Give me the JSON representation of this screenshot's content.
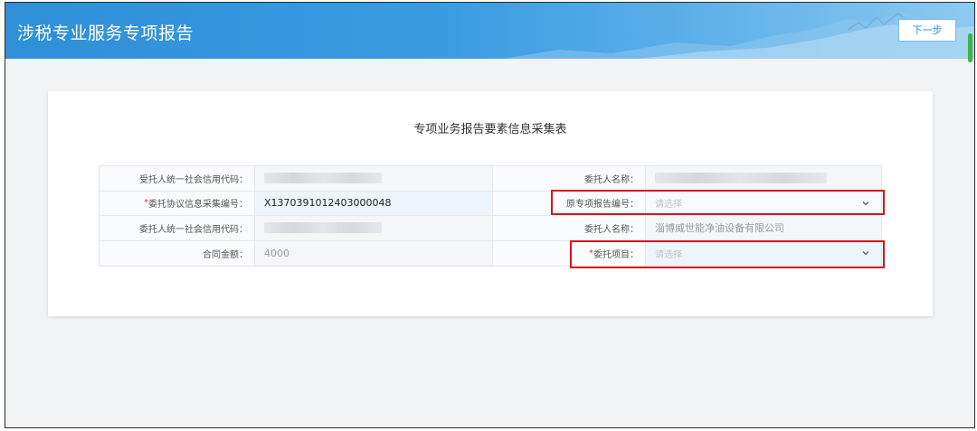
{
  "header": {
    "title": "涉税专业服务专项报告",
    "next_label": "下一步"
  },
  "form": {
    "title": "专项业务报告要素信息采集表",
    "rows": [
      {
        "left_label": "受托人统一社会信用代码：",
        "left_value": "",
        "left_required": false,
        "right_label": "委托人名称：",
        "right_value": "",
        "right_required": false
      },
      {
        "left_label": "委托协议信息采集编号：",
        "left_value": "X1370391012403000048",
        "left_required": true,
        "right_label": "原专项报告编号：",
        "right_placeholder": "请选择",
        "right_required": false
      },
      {
        "left_label": "委托人统一社会信用代码：",
        "left_value": "",
        "left_required": false,
        "right_label": "委托人名称：",
        "right_value": "淄博威世能净油设备有限公司",
        "right_required": false
      },
      {
        "left_label": "合同金额：",
        "left_value": "4000",
        "left_required": false,
        "right_label": "委托项目：",
        "right_placeholder": "请选择",
        "right_required": true
      }
    ]
  },
  "colors": {
    "header_blue": "#2f8fd8",
    "highlight_red": "#d9141b",
    "required_red": "#e23b3b"
  },
  "icons": {
    "select_arrow": "chevron-down-icon",
    "scroll_indicator": "scrollbar-thumb"
  }
}
